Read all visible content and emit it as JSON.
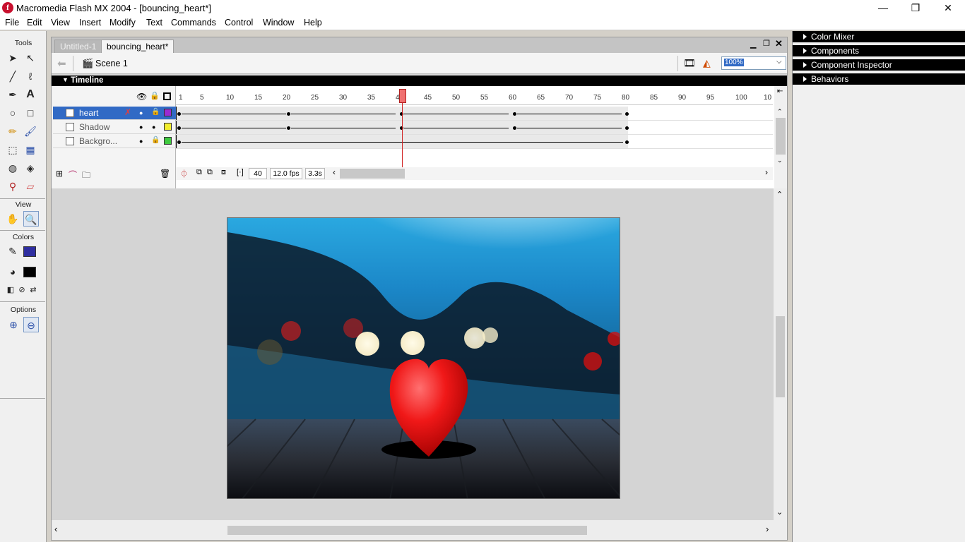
{
  "window": {
    "title": "Macromedia Flash MX 2004 - [bouncing_heart*]",
    "app_icon": "f"
  },
  "menu": [
    "File",
    "Edit",
    "View",
    "Insert",
    "Modify",
    "Text",
    "Commands",
    "Control",
    "Window",
    "Help"
  ],
  "tools": {
    "header": "Tools",
    "view_header": "View",
    "colors_header": "Colors",
    "options_header": "Options",
    "stroke_color": "#2f2ea0",
    "fill_color": "#000000"
  },
  "tabs": [
    {
      "label": "Untitled-1",
      "active": false
    },
    {
      "label": "bouncing_heart*",
      "active": true
    }
  ],
  "scene": {
    "label": "Scene 1",
    "zoom": "100%"
  },
  "timeline": {
    "header": "Timeline",
    "layers": [
      {
        "name": "heart",
        "selected": true,
        "color": "#9b2bd1"
      },
      {
        "name": "Shadow",
        "selected": false,
        "color": "#f2ee2d"
      },
      {
        "name": "Backgro...",
        "selected": false,
        "color": "#3fca3f"
      }
    ],
    "ruler": [
      "1",
      "5",
      "10",
      "15",
      "20",
      "25",
      "30",
      "35",
      "40",
      "45",
      "50",
      "55",
      "60",
      "65",
      "70",
      "75",
      "80",
      "85",
      "90",
      "95",
      "100",
      "10"
    ],
    "current_frame": "40",
    "fps": "12.0 fps",
    "elapsed": "3.3s"
  },
  "right_panels": [
    "Color Mixer",
    "Components",
    "Component Inspector",
    "Behaviors"
  ]
}
